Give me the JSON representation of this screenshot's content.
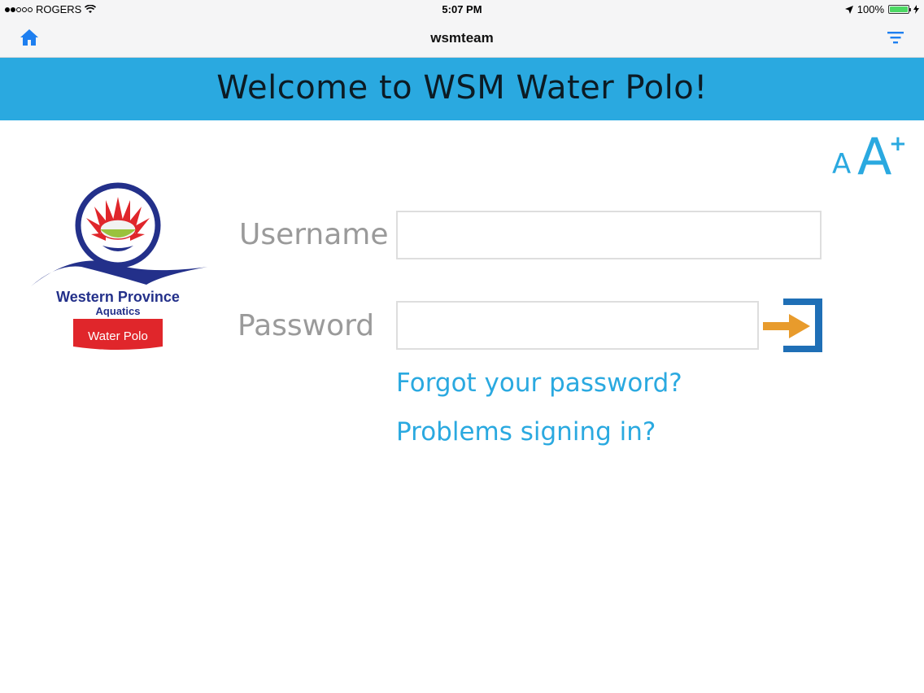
{
  "status_bar": {
    "carrier": "ROGERS",
    "time": "5:07 PM",
    "battery": "100%",
    "signal_bars_filled": 2,
    "signal_bars_total": 5
  },
  "nav": {
    "title": "wsmteam",
    "home_icon": "home-icon",
    "filter_icon": "filter-icon"
  },
  "banner": {
    "title": "Welcome to WSM Water Polo!"
  },
  "font_toggle": {
    "small": "A",
    "big": "A",
    "plus": "+"
  },
  "logo": {
    "line1": "Western Province",
    "line2": "Aquatics",
    "line3": "Water Polo"
  },
  "form": {
    "username_label": "Username",
    "password_label": "Password",
    "username_value": "",
    "password_value": ""
  },
  "links": {
    "forgot": "Forgot your password?",
    "problems": "Problems signing in?"
  },
  "colors": {
    "accent": "#2aa9e0",
    "arrow": "#e89b2c",
    "bracket": "#1f6fb6",
    "logo_blue": "#23308a",
    "logo_red": "#e0262b"
  }
}
